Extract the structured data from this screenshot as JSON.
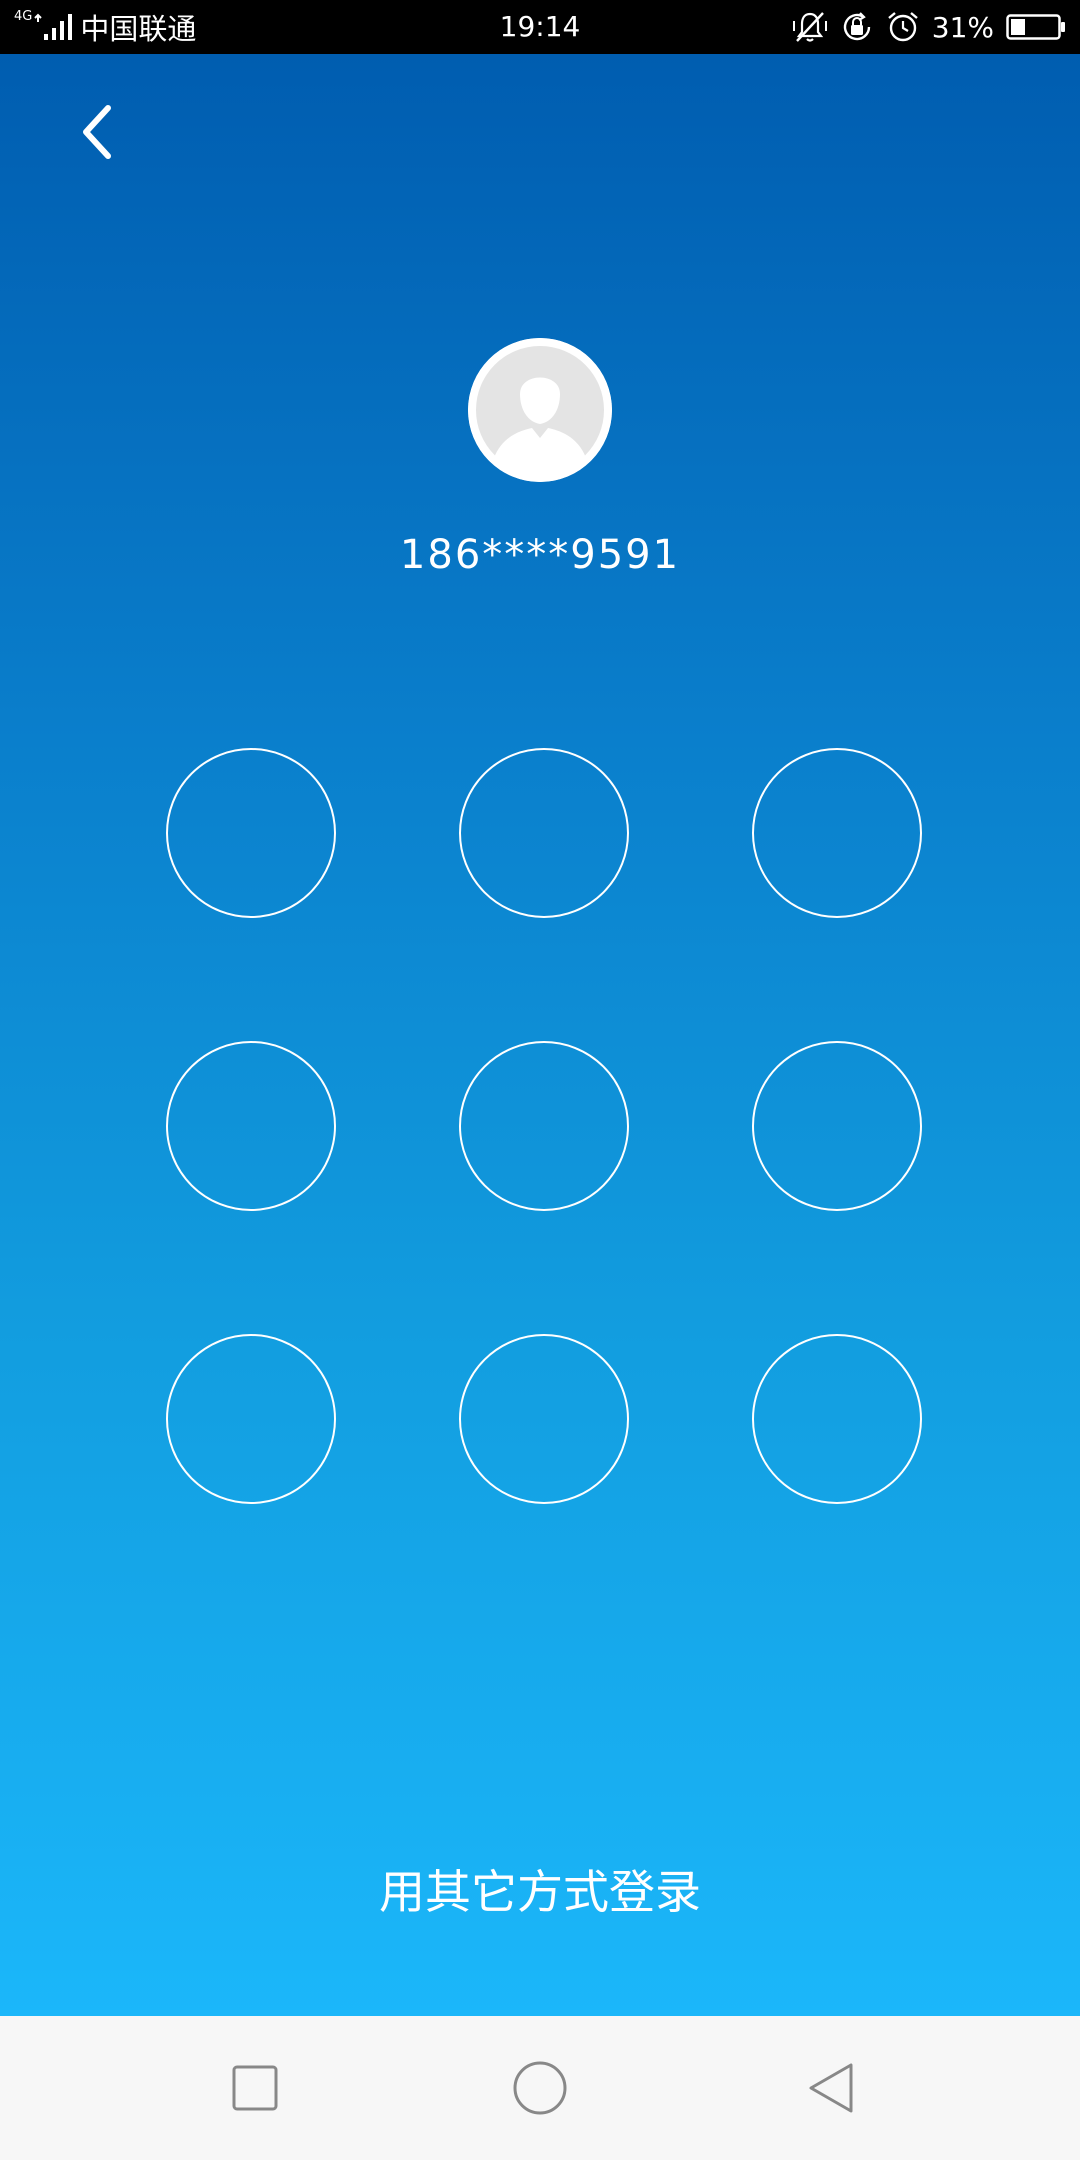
{
  "status_bar": {
    "network_type": "4G",
    "carrier": "中国联通",
    "time": "19:14",
    "battery_percent": "31%",
    "battery_level": 0.31,
    "icons": [
      "vibrate-mute-icon",
      "rotation-lock-icon",
      "alarm-icon",
      "battery-icon"
    ]
  },
  "header": {
    "back_icon": "chevron-left-icon"
  },
  "account": {
    "avatar_icon": "default-user-avatar",
    "phone_masked": "186****9591"
  },
  "pattern_lock": {
    "rows": 3,
    "columns": 3,
    "dot_color": "#ffffff"
  },
  "footer": {
    "other_login_label": "用其它方式登录"
  },
  "nav_bar": {
    "buttons": [
      "recents-square-icon",
      "home-circle-icon",
      "back-triangle-icon"
    ]
  },
  "colors": {
    "gradient_top": "#005db0",
    "gradient_bottom": "#1bb7fa",
    "nav_background": "#f7f7f7",
    "status_background": "#000000"
  }
}
